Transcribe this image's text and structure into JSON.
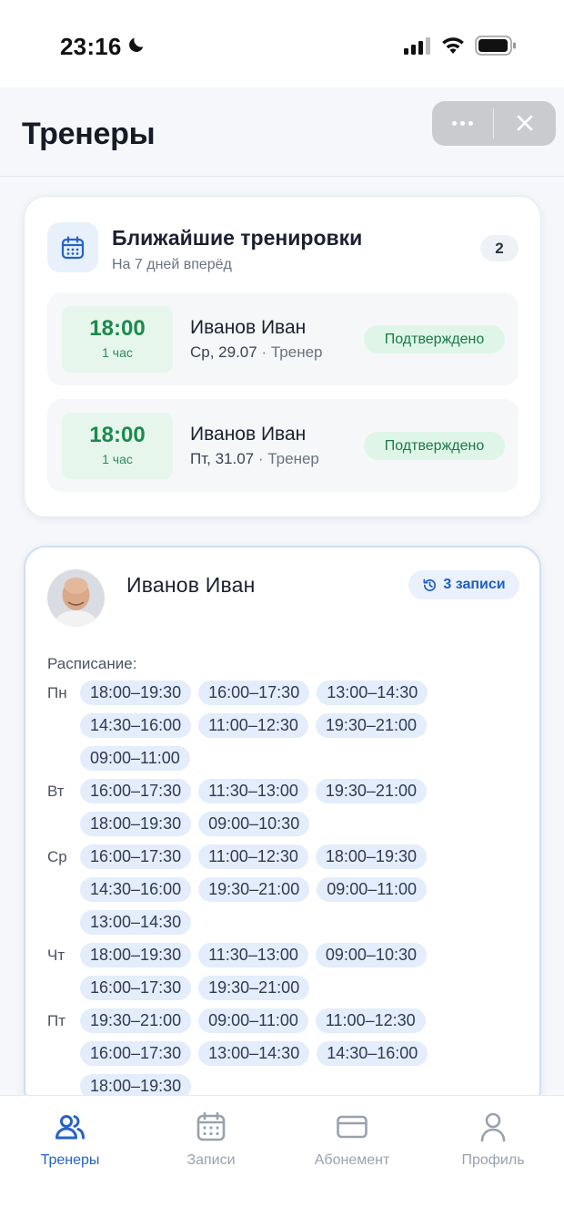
{
  "status_bar": {
    "time": "23:16",
    "icons": [
      "moon-icon",
      "signal-icon",
      "wifi-icon",
      "battery-icon"
    ]
  },
  "header": {
    "title": "Тренеры",
    "more_icon": "more-dots-icon",
    "close_icon": "close-icon"
  },
  "upcoming": {
    "title": "Ближайшие тренировки",
    "subtitle": "На 7 дней вперёд",
    "count": "2",
    "icon": "calendar-icon",
    "sessions": [
      {
        "time": "18:00",
        "duration": "1 час",
        "trainer": "Иванов Иван",
        "date": "Ср, 29.07",
        "role": "· Тренер",
        "status": "Подтверждено"
      },
      {
        "time": "18:00",
        "duration": "1 час",
        "trainer": "Иванов Иван",
        "date": "Пт, 31.07",
        "role": "· Тренер",
        "status": "Подтверждено"
      }
    ]
  },
  "trainer_card": {
    "name": "Иванов Иван",
    "records_badge": "3 записи",
    "records_icon": "history-icon",
    "schedule_label": "Расписание:",
    "schedule": [
      {
        "day": "Пн",
        "slots": [
          "18:00–19:30",
          "16:00–17:30",
          "13:00–14:30",
          "14:30–16:00",
          "11:00–12:30",
          "19:30–21:00",
          "09:00–11:00"
        ]
      },
      {
        "day": "Вт",
        "slots": [
          "16:00–17:30",
          "11:30–13:00",
          "19:30–21:00",
          "18:00–19:30",
          "09:00–10:30"
        ]
      },
      {
        "day": "Ср",
        "slots": [
          "16:00–17:30",
          "11:00–12:30",
          "18:00–19:30",
          "14:30–16:00",
          "19:30–21:00",
          "09:00–11:00",
          "13:00–14:30"
        ]
      },
      {
        "day": "Чт",
        "slots": [
          "18:00–19:30",
          "11:30–13:00",
          "09:00–10:30",
          "16:00–17:30",
          "19:30–21:00"
        ]
      },
      {
        "day": "Пт",
        "slots": [
          "19:30–21:00",
          "09:00–11:00",
          "11:00–12:30",
          "16:00–17:30",
          "13:00–14:30",
          "14:30–16:00",
          "18:00–19:30"
        ]
      }
    ]
  },
  "tabbar": {
    "tabs": [
      {
        "label": "Тренеры",
        "icon": "users-icon",
        "active": true
      },
      {
        "label": "Записи",
        "icon": "calendar-icon",
        "active": false
      },
      {
        "label": "Абонемент",
        "icon": "card-icon",
        "active": false
      },
      {
        "label": "Профиль",
        "icon": "profile-icon",
        "active": false
      }
    ]
  },
  "colors": {
    "accent": "#2563c9",
    "success": "#1b8a4c",
    "chip": "#e3edfb"
  }
}
